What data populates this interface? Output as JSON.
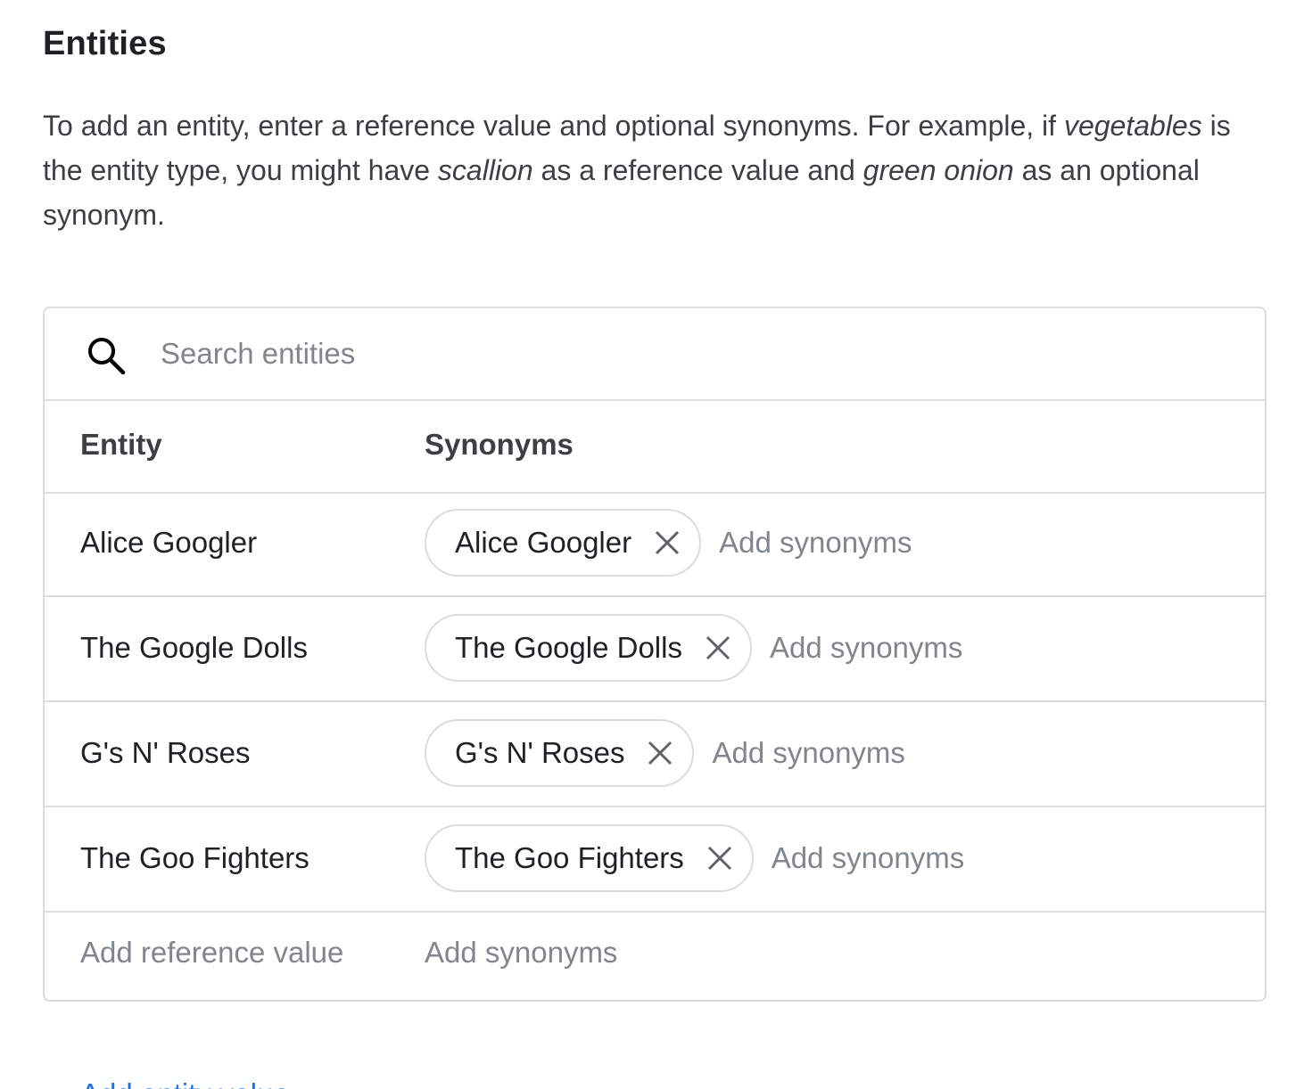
{
  "header": {
    "title": "Entities"
  },
  "description": {
    "p1": "To add an entity, enter a reference value and optional synonyms. For example, if ",
    "em1": "vegetables",
    "p2": " is the entity type, you might have ",
    "em2": "scallion",
    "p3": " as a reference value and ",
    "em3": "green onion",
    "p4": " as an optional synonym."
  },
  "search": {
    "placeholder": "Search entities",
    "icon": "search-icon"
  },
  "table": {
    "columns": {
      "entity": "Entity",
      "synonyms": "Synonyms"
    },
    "rows": [
      {
        "entity": "Alice Googler",
        "synonyms": [
          "Alice Googler"
        ],
        "add_placeholder": "Add synonyms"
      },
      {
        "entity": "The Google Dolls",
        "synonyms": [
          "The Google Dolls"
        ],
        "add_placeholder": "Add synonyms"
      },
      {
        "entity": "G's N' Roses",
        "synonyms": [
          "G's N' Roses"
        ],
        "add_placeholder": "Add synonyms"
      },
      {
        "entity": "The Goo Fighters",
        "synonyms": [
          "The Goo Fighters"
        ],
        "add_placeholder": "Add synonyms"
      }
    ],
    "new_row": {
      "reference_placeholder": "Add reference value",
      "synonyms_placeholder": "Add synonyms"
    }
  },
  "footer": {
    "link_label": "Add entity value"
  },
  "colors": {
    "text": "#202124",
    "placeholder": "#80868b",
    "border": "#dadce0",
    "link": "#1a73e8"
  }
}
